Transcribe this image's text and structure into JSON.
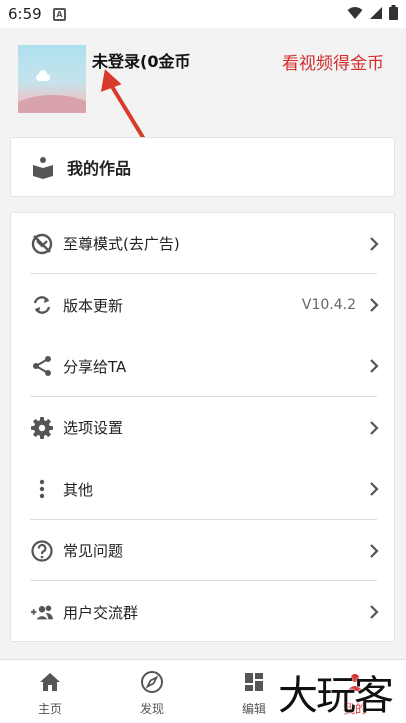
{
  "status_bar": {
    "time": "6:59",
    "notification_glyph": "A"
  },
  "header": {
    "user_name": "未登录(0金币",
    "watch_video_label": "看视频得金币"
  },
  "works": {
    "label": "我的作品"
  },
  "menu": {
    "items": [
      {
        "label": "至尊模式(去广告)",
        "value": "",
        "icon": "no-ads-icon"
      },
      {
        "label": "版本更新",
        "value": "V10.4.2",
        "icon": "sync-icon"
      },
      {
        "label": "分享给TA",
        "value": "",
        "icon": "share-icon"
      },
      {
        "label": "选项设置",
        "value": "",
        "icon": "gear-icon"
      },
      {
        "label": "其他",
        "value": "",
        "icon": "more-vertical-icon"
      },
      {
        "label": "常见问题",
        "value": "",
        "icon": "help-icon"
      },
      {
        "label": "用户交流群",
        "value": "",
        "icon": "group-add-icon"
      }
    ]
  },
  "bottom_nav": {
    "items": [
      {
        "label": "主页",
        "icon": "home-icon"
      },
      {
        "label": "发现",
        "icon": "compass-icon"
      },
      {
        "label": "编辑",
        "icon": "dashboard-icon"
      },
      {
        "label": "我的",
        "icon": "person-icon"
      }
    ]
  },
  "watermark": {
    "text": "大玩客"
  },
  "colors": {
    "accent_red": "#d32f2f",
    "background": "#f3f3f3"
  }
}
